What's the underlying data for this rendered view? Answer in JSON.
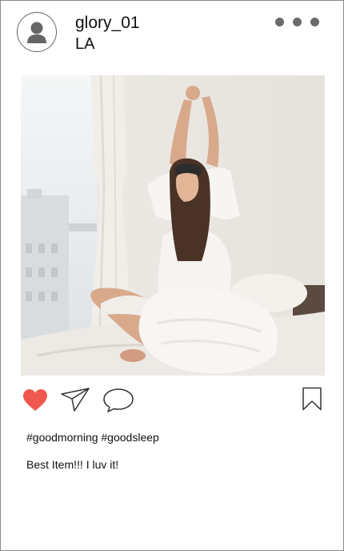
{
  "post": {
    "username": "glory_01",
    "location": "LA",
    "hashtags": "#goodmorning #goodsleep",
    "caption": "Best Item!!! I luv it!",
    "liked": true
  },
  "icons": {
    "avatar": "user-icon",
    "menu": "more-horizontal-icon",
    "like": "heart-icon",
    "share": "send-icon",
    "comment": "comment-bubble-icon",
    "save": "bookmark-icon"
  },
  "colors": {
    "like_active": "#f0584f",
    "icon_gray": "#6b6b6b",
    "text": "#111111"
  }
}
